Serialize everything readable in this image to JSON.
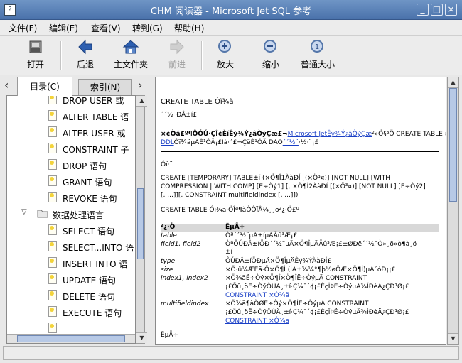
{
  "window": {
    "title": "CHM 阅读器 - Microsoft Jet SQL 参考",
    "icon": "window-icon"
  },
  "menu": [
    "文件(F)",
    "编辑(E)",
    "查看(V)",
    "转到(G)",
    "帮助(H)"
  ],
  "toolbar": {
    "open": "打开",
    "back": "后退",
    "home": "主文件夹",
    "forward": "前进",
    "zoom_in": "放大",
    "zoom_out": "缩小",
    "normal": "普通大小"
  },
  "tabs": {
    "contents": "目录(C)",
    "index": "索引(N)"
  },
  "tree": [
    "DROP USER 或",
    "ALTER TABLE 语",
    "ALTER USER 或",
    "CONSTRAINT 子",
    "DROP 语句",
    "GRANT 语句",
    "REVOKE 语句",
    "数据处理语言",
    "SELECT 语句",
    "SELECT...INTO 语",
    "INSERT INTO 语",
    "UPDATE 语句",
    "DELETE 语句",
    "EXECUTE 语句"
  ],
  "doc": {
    "heading": "CREATE TABLE Óï¾ä",
    "sub": "´´½¨ÐÂ±í£",
    "note_pre": "×¢Òâ£º¶ÔÓÚ·ÇÎ¢ÈíÊý¾Ý¿âÒýÇæ£¬",
    "note_link1": "Microsoft JetÊý¾Ý¿âÒýÇæ",
    "note_mid": "²»Ö§³Ö CREATE TABLE »ò",
    "note_link2": "DDL",
    "note_mid2": "Óï¾äµÄÊ¹ÓÃ¡£Ïà·´£¬ÇëÊ¹ÓÃ DAO",
    "note_link3": "´´½¨",
    "note_end": "·½·¨¡£",
    "syntax_label": "Óï·¨",
    "syntax1": "CREATE [TEMPORARY] TABLE±í (×Ö¶Î1ÀàÐÍ [(×Ö³¤)] [NOT NULL] [WITH",
    "syntax2": "COMPRESSION | WITH COMP] [Ë÷Òý1] [, ×Ö¶Î2ÀàÐÍ [(×Ö³¤)] [NOT NULL] [Ë÷Òý2]",
    "syntax3": "[, ...]][, CONSTRAINT multifieldindex [, ...]])",
    "parts_intro": "CREATE TABLE Óï¾ä·ÖÎª¶àÒÔÏÂ¼¸¸ö²¿·Ö£º",
    "th1": "²¿·Ö",
    "th2": "ËµÃ÷",
    "rows": [
      {
        "k": "table",
        "v": [
          "Òª´´½¨µÄ±íµÄÃû³Æ¡£"
        ]
      },
      {
        "k": "field1, field2",
        "v": [
          "ÒªÔÚÐÂ±íÖÐ´´½¨µÄ×Ö¶ÎµÄÃû³Æ¡£±ØÐë´´½¨Ò»¸ö»ò¶à¸ö",
          "±í"
        ]
      },
      {
        "k": "type",
        "v": [
          "ÔÚÐÂ±íÖÐµÄ×Ö¶ÎµÄÊý¾ÝÀàÐÍ£"
        ]
      },
      {
        "k": "size",
        "v": [
          "×Ö·û¼ÆËã·Ö×Ö¶Î (ÎÄ±¾¼°¶þ½øÖÆ×Ö¶Î)µÄ´óÐ¡¡£"
        ]
      },
      {
        "k": "index1, index2",
        "v": [
          "×Ö¾äË÷Òý×Ö¶Î×Ö¶ÎË÷ÒýµÄ CONSTRAINT",
          "¡£Õû¸öË÷ÒýÔÚÄ¸±í·Ç¼¯´¢¡£ÈçÎÞË÷ÒýµÄ¾ÍÐèÄ¿ÇÐ¹Ø¡£"
        ]
      },
      {
        "k": "multifieldindex",
        "v": [
          "×Ö¾ä¶àÖØË÷Òý×Ö¶ÎË÷ÒýµÄ CONSTRAINT",
          "¡£Õû¸öË÷ÒýÔÚÄ¸±í·Ç¼¯´¢¡£ÈçÎÞË÷ÒýµÄ¾ÍÐèÄ¿ÇÐ¹Ø¡£"
        ]
      }
    ],
    "constraint_link": "CONSTRAINT ×Ó¾ä",
    "remark": "ËµÃ÷"
  }
}
